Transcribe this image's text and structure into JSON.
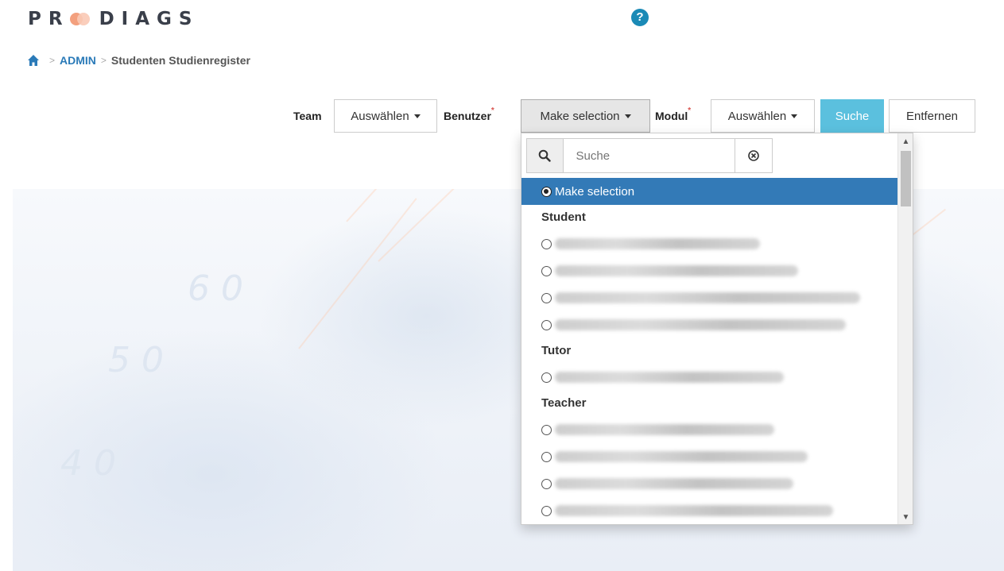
{
  "header": {
    "logo_text": "PR DIAGS",
    "help_icon": "question-circle-icon"
  },
  "breadcrumb": {
    "home_icon": "home-icon",
    "items": [
      "ADMIN",
      "Studenten Studienregister"
    ]
  },
  "filters": {
    "team": {
      "label": "Team",
      "value": "Auswählen"
    },
    "benutzer": {
      "label": "Benutzer",
      "required_mark": "*",
      "value": "Make selection"
    },
    "modul": {
      "label": "Modul",
      "required_mark": "*",
      "value": "Auswählen"
    },
    "search_button": "Suche",
    "remove_button": "Entfernen"
  },
  "dropdown": {
    "search_placeholder": "Suche",
    "selected_option": "Make selection",
    "groups": [
      {
        "name": "Student",
        "options": [
          "",
          "",
          "",
          ""
        ]
      },
      {
        "name": "Tutor",
        "options": [
          ""
        ]
      },
      {
        "name": "Teacher",
        "options": [
          "",
          "",
          "",
          ""
        ]
      }
    ]
  },
  "colors": {
    "primary_blue": "#337ab7",
    "info_button": "#5bc0de",
    "link_blue": "#2a7ab8",
    "help_icon": "#1a8ab6",
    "required": "#d9534f",
    "logo_accent": "#f3a07e"
  }
}
